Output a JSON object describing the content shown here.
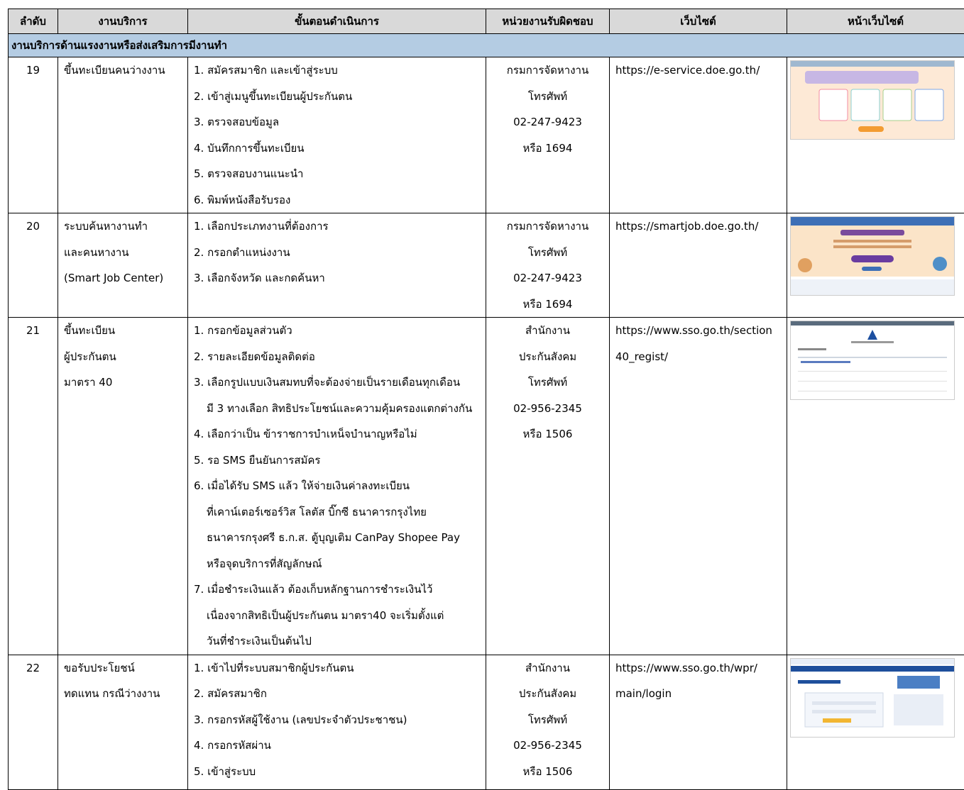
{
  "headers": [
    "ลำดับ",
    "งานบริการ",
    "ขั้นตอนดำเนินการ",
    "หน่วยงานรับผิดชอบ",
    "เว็บไซต์",
    "หน้าเว็บไซต์"
  ],
  "section_title": "งานบริการด้านแรงงานหรือส่งเสริมการมีงานทำ",
  "rows": [
    {
      "num": "19",
      "service": [
        "ขึ้นทะเบียนคนว่างงาน"
      ],
      "steps": [
        "1. สมัครสมาชิก และเข้าสู่ระบบ",
        "2. เข้าสู่เมนูขึ้นทะเบียนผู้ประกันตน",
        "3. ตรวจสอบข้อมูล",
        "4. บันทึกการขึ้นทะเบียน",
        "5. ตรวจสอบงานแนะนำ",
        "6. พิมพ์หนังสือรับรอง"
      ],
      "agency": [
        "กรมการจัดหางาน",
        "โทรศัพท์",
        "02-247-9423",
        "หรือ 1694"
      ],
      "website": [
        "https://e-service.doe.go.th/"
      ]
    },
    {
      "num": "20",
      "service": [
        "ระบบค้นหางานทำ",
        "และคนหางาน",
        "(Smart Job Center)"
      ],
      "steps": [
        "1. เลือกประเภทงานที่ต้องการ",
        "2. กรอกตำแหน่งงาน",
        "3. เลือกจังหวัด และกดค้นหา"
      ],
      "agency": [
        "กรมการจัดหางาน",
        "โทรศัพท์",
        "02-247-9423",
        "หรือ 1694"
      ],
      "website": [
        "https://smartjob.doe.go.th/"
      ]
    },
    {
      "num": "21",
      "service": [
        "ขึ้นทะเบียน",
        "ผู้ประกันตน",
        "มาตรา 40"
      ],
      "steps": [
        "1. กรอกข้อมูลส่วนตัว",
        "2. รายละเอียดข้อมูลติดต่อ",
        "3. เลือกรูปแบบเงินสมทบที่จะต้องจ่ายเป็นรายเดือนทุกเดือน",
        "มี 3 ทางเลือก สิทธิประโยชน์และความคุ้มครองแตกต่างกัน",
        "4. เลือกว่าเป็น ข้าราชการบำเหน็จบำนาญหรือไม่",
        "5. รอ SMS ยืนยันการสมัคร",
        "6. เมื่อได้รับ SMS แล้ว ให้จ่ายเงินค่าลงทะเบียน",
        "ที่เคาน์เตอร์เซอร์วิส โลตัส บิ๊กซี ธนาคารกรุงไทย",
        "ธนาคารกรุงศรี ธ.ก.ส. ตู้บุญเติม CanPay Shopee Pay",
        "หรือจุดบริการที่สัญลักษณ์",
        "7. เมื่อชำระเงินแล้ว ต้องเก็บหลักฐานการชำระเงินไว้",
        "เนื่องจากสิทธิเป็นผู้ประกันตน มาตรา40 จะเริ่มตั้งแต่",
        "วันที่ชำระเงินเป็นต้นไป"
      ],
      "agency": [
        "สำนักงาน",
        "ประกันสังคม",
        "โทรศัพท์",
        "02-956-2345",
        "หรือ 1506"
      ],
      "website": [
        "https://www.sso.go.th/section",
        "40_regist/"
      ]
    },
    {
      "num": "22",
      "service": [
        "ขอรับประโยชน์",
        "ทดแทน กรณีว่างงาน"
      ],
      "steps": [
        "1. เข้าไปที่ระบบสมาชิกผู้ประกันตน",
        "2. สมัครสมาชิก",
        "3. กรอกรหัสผู้ใช้งาน (เลขประจำตัวประชาชน)",
        "4. กรอกรหัสผ่าน",
        "5.  เข้าสู่ระบบ"
      ],
      "agency": [
        "สำนักงาน",
        "ประกันสังคม",
        "โทรศัพท์",
        "02-956-2345",
        "หรือ 1506"
      ],
      "website": [
        "https://www.sso.go.th/wpr/",
        "main/login"
      ]
    }
  ]
}
